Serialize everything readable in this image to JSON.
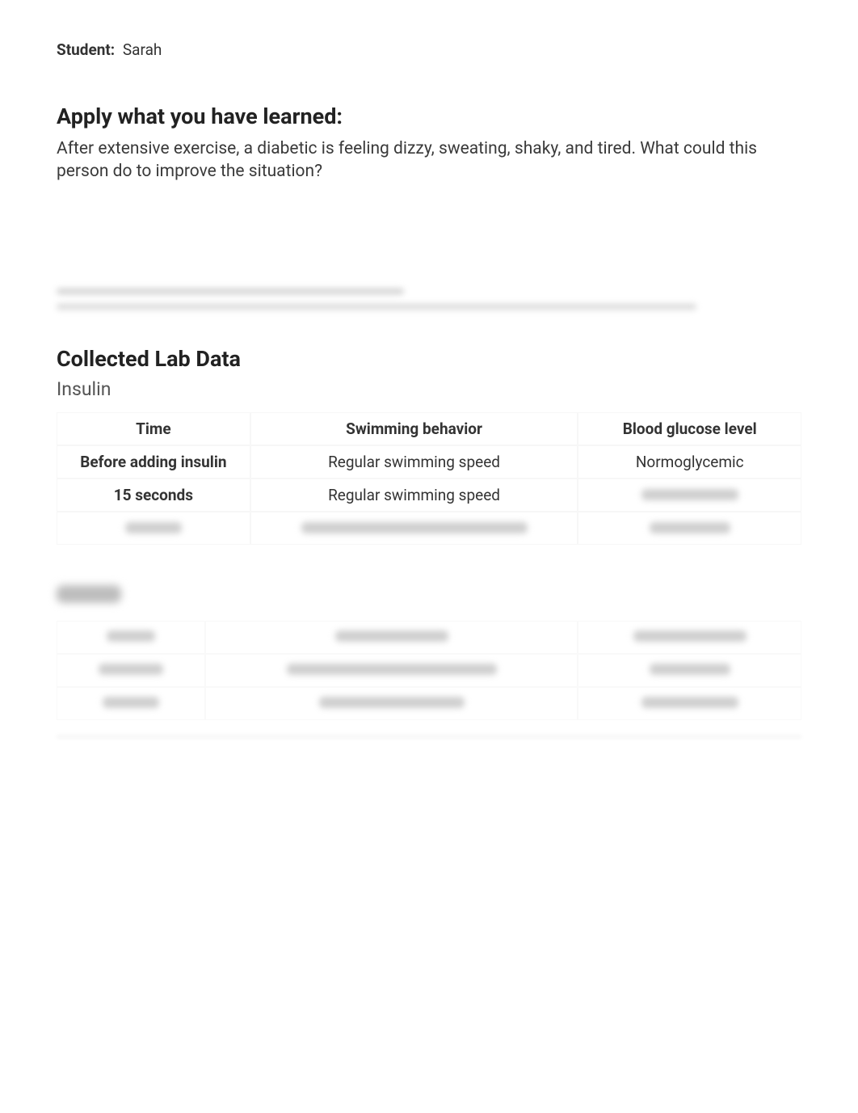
{
  "student": {
    "label": "Student:",
    "name": "Sarah"
  },
  "apply": {
    "heading": "Apply what you have learned:",
    "question": "After extensive exercise, a diabetic is feeling dizzy, sweating, shaky, and tired. What could this person do to improve the situation?"
  },
  "lab": {
    "heading": "Collected Lab Data",
    "subtitle": "Insulin",
    "columns": {
      "c1": "Time",
      "c2": "Swimming behavior",
      "c3": "Blood glucose level"
    },
    "rows": [
      {
        "time": "Before adding insulin",
        "behavior": "Regular swimming speed",
        "glucose": "Normoglycemic"
      },
      {
        "time": "15 seconds",
        "behavior": "Regular swimming speed",
        "glucose": ""
      }
    ]
  }
}
